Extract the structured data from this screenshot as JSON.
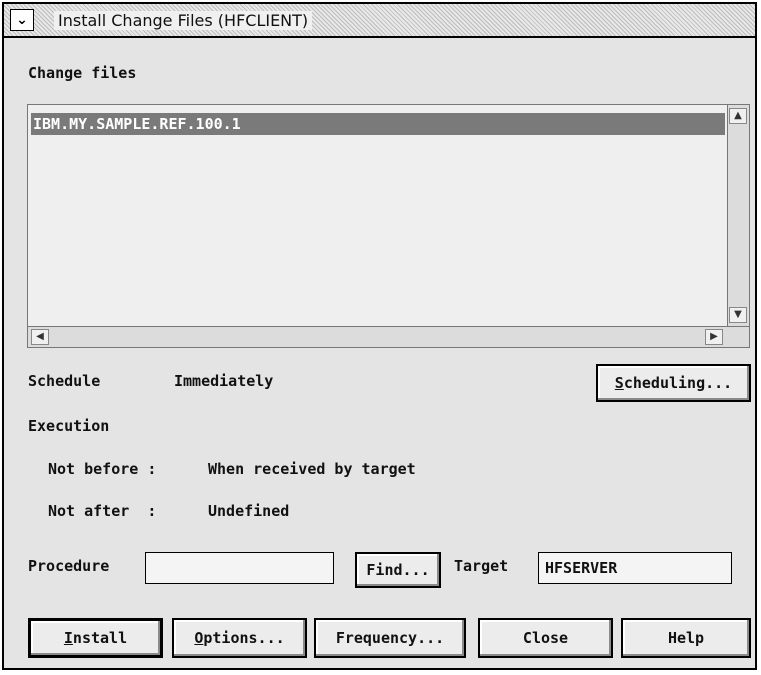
{
  "window": {
    "title": "Install Change Files (HFCLIENT)",
    "system_menu_icon": "system-menu-icon"
  },
  "change_files": {
    "label": "Change files",
    "items": [
      "IBM.MY.SAMPLE.REF.100.1"
    ],
    "selected_index": 0
  },
  "schedule": {
    "label": "Schedule",
    "value": "Immediately",
    "button_label": "Scheduling...",
    "button_mnemonic": "S",
    "button_rest": "cheduling..."
  },
  "execution": {
    "label": "Execution",
    "not_before_label": "Not before :",
    "not_before_value": "When received by target",
    "not_after_label": "Not after  :",
    "not_after_value": "Undefined"
  },
  "procedure": {
    "label": "Procedure",
    "value": "",
    "find_label": "Find..."
  },
  "target": {
    "label": "Target",
    "value": "HFSERVER"
  },
  "buttons": {
    "install_mnemonic": "I",
    "install_rest": "nstall",
    "options_mnemonic": "O",
    "options_rest": "ptions...",
    "frequency": "Frequency...",
    "close": "Close",
    "help": "Help"
  },
  "icons": {
    "scroll_up": "▲",
    "scroll_down": "▼",
    "scroll_left": "◀",
    "scroll_right": "▶",
    "system_menu": "⌄"
  }
}
